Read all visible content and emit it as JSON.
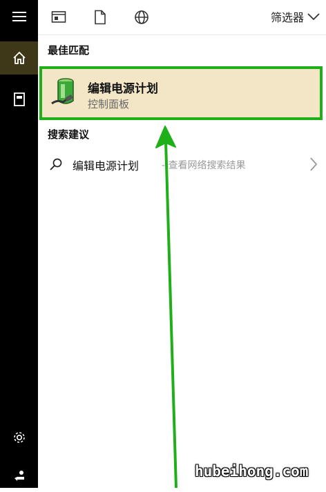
{
  "topbar": {
    "filter_label": "筛选器"
  },
  "sections": {
    "best_match": "最佳匹配",
    "search_suggestions": "搜索建议"
  },
  "best_result": {
    "title": "编辑电源计划",
    "subtitle": "控制面板"
  },
  "suggestion": {
    "query": "编辑电源计划",
    "hint": "- 查看网络搜索结果"
  },
  "watermark": "hubeihong.com",
  "colors": {
    "highlight_border": "#1fb019",
    "highlight_bg": "#f2e6c6",
    "rail_bg": "#000000",
    "rail_active": "#3f3818",
    "annotation_arrow": "#1fb019"
  }
}
